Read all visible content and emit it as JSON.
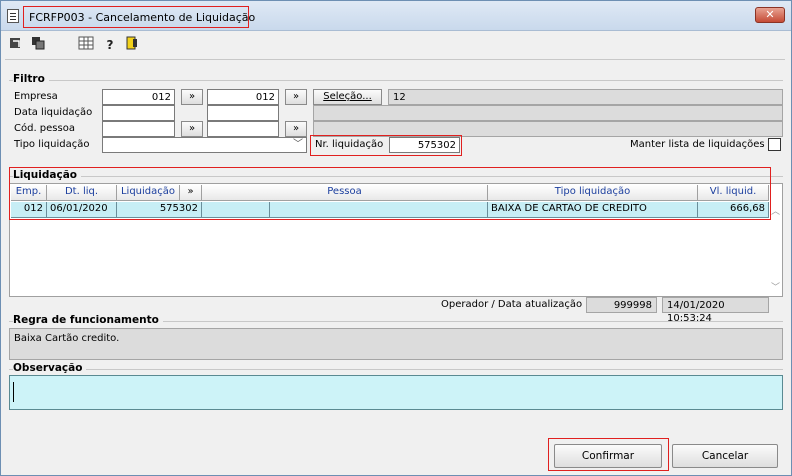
{
  "window": {
    "title": "FCRFP003 - Cancelamento de Liquidação",
    "close_label": "✕"
  },
  "toolbar": {
    "icons": [
      "exit-icon",
      "copy-icon",
      "calculator-icon",
      "help-icon",
      "door-icon"
    ]
  },
  "filtro": {
    "title": "Filtro",
    "empresa_label": "Empresa",
    "empresa_from": "012",
    "empresa_to": "012",
    "data_label": "Data liquidação",
    "cod_pessoa_label": "Cód. pessoa",
    "tipo_label": "Tipo liquidação",
    "arrow_btn": "»",
    "selecao_btn": "Seleção...",
    "selecao_value": "12",
    "nr_label": "Nr. liquidação",
    "nr_value": "575302",
    "manter_label": "Manter lista de liquidações"
  },
  "liquidacao": {
    "title": "Liquidação",
    "columns": [
      "Emp.",
      "Dt. liq.",
      "Liquidação",
      "»",
      "Pessoa",
      "Tipo liquidação",
      "Vl. liquid."
    ],
    "rows": [
      {
        "emp": "012",
        "dt": "06/01/2020",
        "liq": "575302",
        "pessoa_cod": "",
        "pessoa": "",
        "tipo": "BAIXA DE CARTAO DE CREDITO",
        "valor": "666,68"
      }
    ],
    "operador_label": "Operador / Data atualização",
    "operador_value": "999998",
    "data_atualizacao": "14/01/2020 10:53:24"
  },
  "regra": {
    "title": "Regra de funcionamento",
    "text": "Baixa Cartão credito."
  },
  "observacao": {
    "title": "Observação",
    "text": ""
  },
  "buttons": {
    "confirmar": "Confirmar",
    "cancelar": "Cancelar"
  }
}
